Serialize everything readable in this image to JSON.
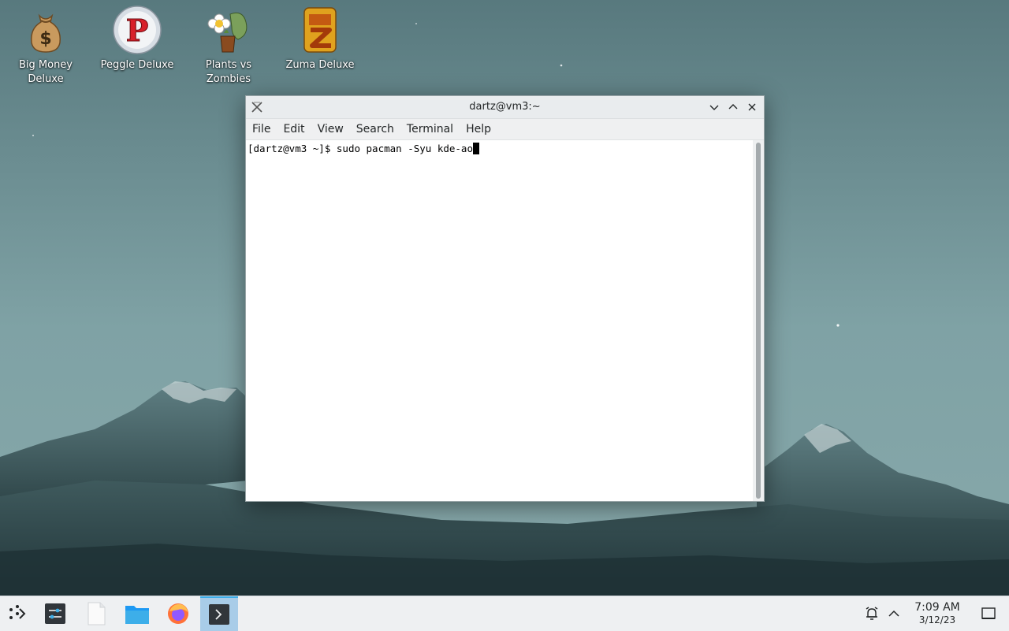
{
  "desktop": {
    "icons": [
      {
        "label": "Big Money Deluxe",
        "icon": "money-bag-icon"
      },
      {
        "label": "Peggle Deluxe",
        "icon": "peggle-icon"
      },
      {
        "label": "Plants vs Zombies",
        "icon": "plants-vs-zombies-icon"
      },
      {
        "label": "Zuma Deluxe",
        "icon": "zuma-icon"
      }
    ]
  },
  "window": {
    "title": "dartz@vm3:~",
    "menu": [
      "File",
      "Edit",
      "View",
      "Search",
      "Terminal",
      "Help"
    ],
    "prompt": "[dartz@vm3 ~]$ ",
    "command": "sudo pacman -Syu kde-ao"
  },
  "taskbar": {
    "apps": [
      "app-launcher-icon",
      "system-settings-icon",
      "text-file-icon",
      "dolphin-folder-icon",
      "firefox-icon",
      "terminal-icon"
    ],
    "time": "7:09 AM",
    "date": "3/12/23"
  },
  "colors": {
    "accent": "#3daee9",
    "taskbar": "#eef0f2"
  }
}
